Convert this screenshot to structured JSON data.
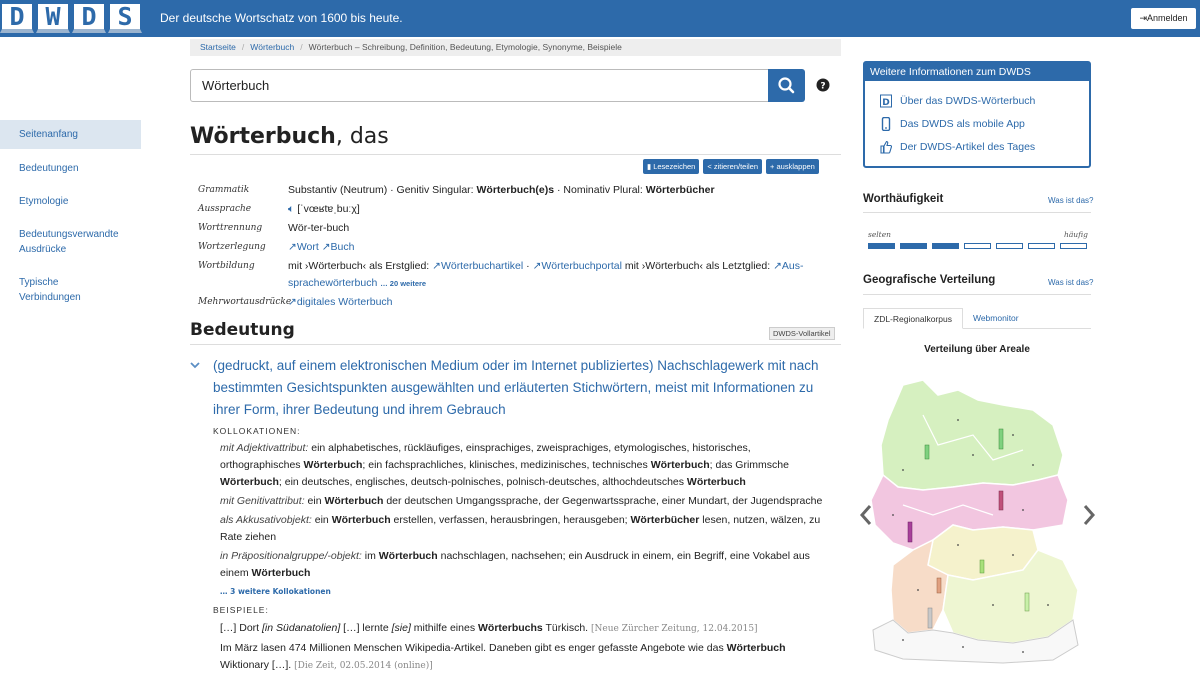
{
  "header": {
    "logo_letters": [
      "D",
      "W",
      "D",
      "S"
    ],
    "tagline": "Der deutsche Wortschatz von 1600 bis heute.",
    "login_label": "Anmelden"
  },
  "leftnav": {
    "items": [
      {
        "label": "Seitenanfang",
        "active": true
      },
      {
        "label": "Bedeutungen"
      },
      {
        "label": "Etymologie"
      },
      {
        "label": "Bedeutungsverwandte Ausdrücke"
      },
      {
        "label": "Typische Verbindungen"
      }
    ]
  },
  "breadcrumb": {
    "home": "Startseite",
    "section": "Wörterbuch",
    "current": "Wörterbuch – Schreibung, Definition, Bedeutung, Etymologie, Synonyme, Beispiele",
    "separator": "/"
  },
  "search": {
    "value": "Wörterbuch"
  },
  "entry": {
    "lemma": "Wörterbuch",
    "article": ", das",
    "buttons": {
      "bookmark": "Lesezeichen",
      "cite": "zitieren/teilen",
      "expand": "ausklappen"
    },
    "grammar": {
      "grammatik_label": "Grammatik",
      "grammatik_1": "Substantiv (Neutrum) · Genitiv Singular: ",
      "genitiv": "Wörterbuch(e)s",
      "grammatik_2": " · Nominativ Plural: ",
      "plural": "Wörterbücher",
      "aussprache_label": "Aussprache",
      "aussprache": "[ˈvœʁtɐˌbuːχ]",
      "worttrennung_label": "Worttrennung",
      "worttrennung": "Wör-ter-buch",
      "wortzerlegung_label": "Wortzerlegung",
      "wz_1": "Wort",
      "wz_2": "Buch",
      "wortbildung_label": "Wortbildung",
      "wb_1": "mit ›Wörterbuch‹ als Erstglied: ",
      "wb_l1": "Wörterbuchartikel",
      "wb_l2": "Wörterbuchportal",
      "wb_2": " mit ›Wörterbuch‹ als Letztglied: ",
      "wb_l3a": "Aus-",
      "wb_l3b": "sprachewörterbuch",
      "wb_more": "… 20 weitere",
      "mehrwort_label": "Mehrwortausdrücke",
      "mehrwort": "digitales Wörterbuch"
    }
  },
  "bedeutung": {
    "title": "Bedeutung",
    "vollartikel": "DWDS-Vollartikel",
    "definition": "(gedruckt, auf einem elektronischen Medium oder im Internet publiziertes) Nachschlagewerk mit nach bestimmten Gesichtspunkten ausgewählten und erläuterten Stichwörtern, meist mit Informationen zu ihrer Form, ihrer Bedeutung und ihrem Gebrauch",
    "kollokationen_label": "Kollokationen:",
    "koll": [
      {
        "label": "mit Adjektivattribut:",
        "parts": [
          " ein alphabetisches, rückläufiges, einsprachiges, zweisprachiges, etymologisches, historisches, orthographisches ",
          "Wörterbuch",
          "; ein fachsprachliches, klinisches, medizinisches, technisches ",
          "Wörterbuch",
          "; das Grimmsche ",
          "Wörterbuch",
          "; ein deutsches, englisches, deutsch-polnisches, polnisch-deutsches, althochdeutsches ",
          "Wörterbuch",
          ""
        ]
      },
      {
        "label": "mit Genitivattribut:",
        "parts": [
          " ein ",
          "Wörterbuch",
          " der deutschen Umgangssprache, der Gegenwartssprache, einer Mundart, der Jugendsprache"
        ]
      },
      {
        "label": "als Akkusativobjekt:",
        "parts": [
          " ein ",
          "Wörterbuch",
          " erstellen, verfassen, herausbringen, herausgeben; ",
          "Wörterbücher",
          " lesen, nutzen, wälzen, zu Rate ziehen"
        ]
      },
      {
        "label": "in Präpositionalgruppe/-objekt:",
        "parts": [
          " im ",
          "Wörterbuch",
          " nachschlagen, nachsehen; ein Ausdruck in einem, ein Begriff, eine Vokabel aus einem ",
          "Wörterbuch",
          ""
        ]
      }
    ],
    "koll_more": "… 3 weitere Kollokationen",
    "beispiele_label": "Beispiele:",
    "b1": {
      "t1": "[…] Dort ",
      "i1": "[in Südanatolien]",
      "t2": " […] lernte ",
      "i2": "[sie]",
      "t3": " mithilfe eines ",
      "b": "Wörterbuchs",
      "t4": " Türkisch. ",
      "src": "[Neue Zürcher Zeitung, 12.04.2015]"
    },
    "b2": {
      "t1": "Im März lasen 474 Millionen Menschen Wikipedia-Artikel. Daneben gibt es enger gefasste Angebote wie das ",
      "b": "Wörterbuch",
      "t2": " Wiktionary […]. ",
      "src": "[Die Zeit, 02.05.2014 (online)]"
    }
  },
  "sidebar": {
    "info_title": "Weitere Informationen zum DWDS",
    "info_items": [
      "Über das DWDS-Wörterbuch",
      "Das DWDS als mobile App",
      "Der DWDS-Artikel des Tages"
    ],
    "freq_title": "Worthäufigkeit",
    "freq_link": "Was ist das?",
    "freq_low": "selten",
    "freq_high": "häufig",
    "freq_level": 3,
    "freq_max": 7,
    "geo_title": "Geografische Verteilung",
    "geo_link": "Was ist das?",
    "tab_1": "ZDL-Regionalkorpus",
    "tab_2": "Webmonitor",
    "map_title": "Verteilung über Areale"
  },
  "colors": {
    "brand": "#2d6aaa"
  }
}
